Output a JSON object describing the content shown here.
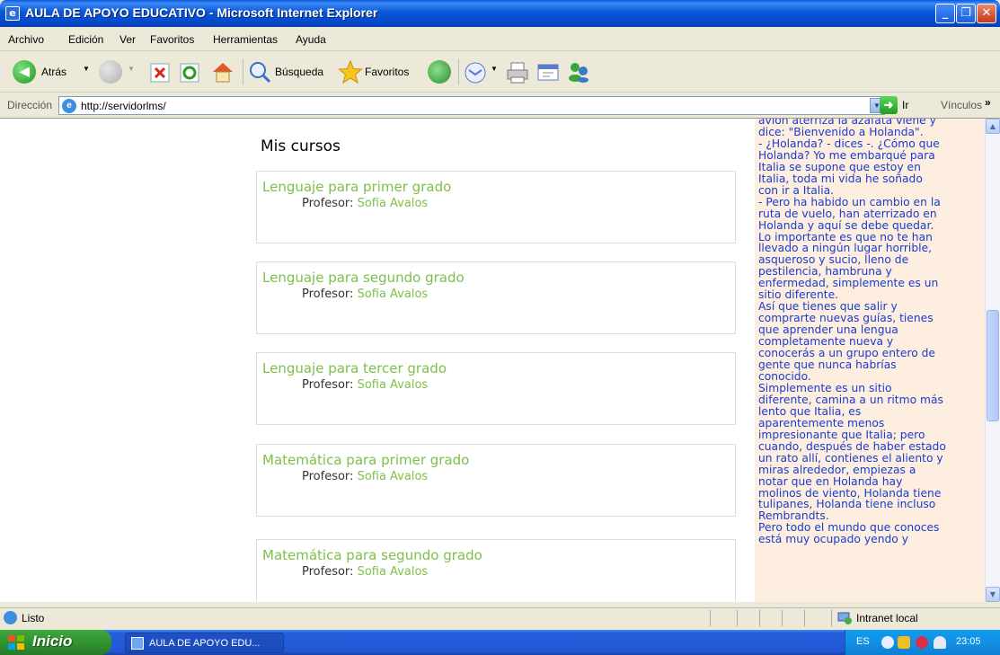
{
  "window": {
    "title": "AULA DE APOYO EDUCATIVO - Microsoft Internet Explorer",
    "minimize_icon": "minimize-icon",
    "maximize_icon": "maximize-icon",
    "close_icon": "close-icon"
  },
  "menubar": {
    "items": [
      "Archivo",
      "Edición",
      "Ver",
      "Favoritos",
      "Herramientas",
      "Ayuda"
    ]
  },
  "toolbar": {
    "back_label": "Atrás",
    "search_label": "Búsqueda",
    "favorites_label": "Favoritos"
  },
  "address": {
    "label": "Dirección",
    "url": "http://servidorlms/",
    "go_label": "Ir",
    "links_label": "Vínculos"
  },
  "main": {
    "heading": "Mis cursos",
    "teacher_prefix": "Profesor:",
    "courses": [
      {
        "title": "Lenguaje para primer grado",
        "teacher": "Sofia Avalos"
      },
      {
        "title": "Lenguaje para segundo grado",
        "teacher": "Sofia Avalos"
      },
      {
        "title": "Lenguaje para tercer grado",
        "teacher": "Sofia Avalos"
      },
      {
        "title": "Matemática para primer grado",
        "teacher": "Sofia Avalos"
      },
      {
        "title": "Matemática para segundo grado",
        "teacher": "Sofia Avalos"
      }
    ]
  },
  "side_panel": {
    "lines": [
      "avión aterriza la azafata viene y",
      "dice: \"Bienvenido a Holanda\".",
      "- ¿Holanda? - dices -. ¿Cómo que",
      "Holanda? Yo me embarqué para",
      "Italia se supone que estoy en",
      "Italia, toda mi vida he soñado",
      "con ir a Italia.",
      "- Pero ha habido un cambio en la",
      "ruta de vuelo, han aterrizado en",
      "Holanda y aquí se debe quedar.",
      "Lo importante es que no te han",
      "llevado a ningún lugar horrible,",
      "asqueroso y sucio, lleno de",
      "pestilencia, hambruna y",
      "enfermedad, simplemente es un",
      "sitio diferente.",
      "Así que tienes que salir y",
      "comprarte nuevas guías, tienes",
      "que aprender una lengua",
      "completamente nueva y",
      "conocerás a un grupo entero de",
      "gente que nunca habrías",
      "conocido.",
      "Simplemente es un sitio",
      "diferente, camina a un ritmo más",
      "lento que Italia, es",
      "aparentemente menos",
      "impresionante que Italia; pero",
      "cuando, después de haber estado",
      "un rato allí, contienes el aliento y",
      "miras alrededor, empiezas a",
      "notar que en Holanda hay",
      "molinos de viento, Holanda tiene",
      "tulipanes, Holanda tiene incluso",
      "Rembrandts.",
      "Pero todo el mundo que conoces",
      "está muy ocupado yendo y"
    ]
  },
  "statusbar": {
    "status": "Listo",
    "zone": "Intranet local"
  },
  "taskbar": {
    "start_label": "Inicio",
    "task_label": "AULA DE APOYO EDU...",
    "language": "ES",
    "clock": "23:05"
  },
  "colors": {
    "course_link": "#7cc04a",
    "side_text": "#1a3ccc",
    "side_bg": "#fdeee0",
    "titlebar": "#0857d8"
  }
}
